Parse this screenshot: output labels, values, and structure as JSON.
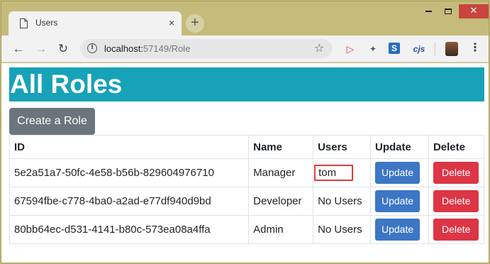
{
  "browser": {
    "tab_title": "Users",
    "url_host": "localhost:",
    "url_path": "57149/Role",
    "extensions": [
      "cast-icon",
      "cross-icon",
      "s-icon",
      "cjs-icon"
    ],
    "ext_cjs_label": "cjs",
    "ext_s_label": "S",
    "new_tab_label": "+",
    "close_tab_label": "×",
    "close_window_label": "✕"
  },
  "page": {
    "title": "All Roles",
    "create_button": "Create a Role",
    "table": {
      "headers": [
        "ID",
        "Name",
        "Users",
        "Update",
        "Delete"
      ],
      "rows": [
        {
          "id": "5e2a51a7-50fc-4e58-b56b-829604976710",
          "name": "Manager",
          "users": "tom",
          "update": "Update",
          "delete": "Delete"
        },
        {
          "id": "67594fbe-c778-4ba0-a2ad-e77df940d9bd",
          "name": "Developer",
          "users": "No Users",
          "update": "Update",
          "delete": "Delete"
        },
        {
          "id": "80bb64ec-d531-4141-b80c-573ea08a4ffa",
          "name": "Admin",
          "users": "No Users",
          "update": "Update",
          "delete": "Delete"
        }
      ]
    }
  },
  "colors": {
    "heading_bg": "#17a2b8",
    "create_button_bg": "#6c757d",
    "update_button_bg": "#3c76c5",
    "delete_button_bg": "#dc3545",
    "highlight_border": "#e03c3c"
  }
}
